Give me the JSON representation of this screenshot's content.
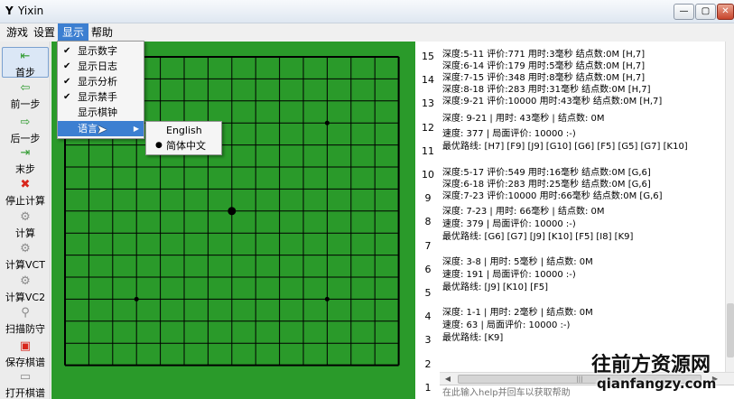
{
  "window": {
    "title": "Yixin",
    "icon": "app-logo-icon"
  },
  "window_controls": {
    "minimize": "—",
    "maximize": "▢",
    "close": "✕"
  },
  "menubar": [
    {
      "label": "游戏"
    },
    {
      "label": "设置"
    },
    {
      "label": "显示",
      "active": true
    },
    {
      "label": "帮助"
    }
  ],
  "toolbar": [
    {
      "label": "首步",
      "icon": "first-step-icon",
      "glyph": "⇤",
      "color": "green",
      "selected": true
    },
    {
      "label": "前一步",
      "icon": "prev-step-icon",
      "glyph": "⇦",
      "color": "green"
    },
    {
      "label": "后一步",
      "icon": "next-step-icon",
      "glyph": "⇨",
      "color": "green"
    },
    {
      "label": "末步",
      "icon": "last-step-icon",
      "glyph": "⇥",
      "color": "green"
    },
    {
      "label": "停止计算",
      "icon": "stop-icon",
      "glyph": "✖",
      "color": "red"
    },
    {
      "label": "计算",
      "icon": "gear-icon",
      "glyph": "⚙",
      "color": "gray"
    },
    {
      "label": "计算VCT",
      "icon": "gear-icon",
      "glyph": "⚙",
      "color": "gray"
    },
    {
      "label": "计算VC2",
      "icon": "gear-icon",
      "glyph": "⚙",
      "color": "gray"
    },
    {
      "label": "扫描防守",
      "icon": "search-icon",
      "glyph": "⚲",
      "color": "gray"
    },
    {
      "label": "保存棋谱",
      "icon": "save-icon",
      "glyph": "▣",
      "color": "red"
    },
    {
      "label": "打开棋谱",
      "icon": "open-folder-icon",
      "glyph": "▭",
      "color": "gray"
    }
  ],
  "display_menu": [
    {
      "label": "显示数字",
      "checked": true
    },
    {
      "label": "显示日志",
      "checked": true
    },
    {
      "label": "显示分析",
      "checked": true
    },
    {
      "label": "显示禁手",
      "checked": true
    },
    {
      "label": "显示棋钟",
      "checked": false
    },
    {
      "label": "语言",
      "checked": false,
      "submenu": true,
      "highlight": true
    }
  ],
  "language_submenu": [
    {
      "label": "English",
      "selected": false
    },
    {
      "label": "简体中文",
      "selected": true
    }
  ],
  "board": {
    "size": 15,
    "stones": [
      {
        "col": 8,
        "row": 8,
        "color": "black"
      }
    ],
    "star_points": [
      [
        4,
        4
      ],
      [
        12,
        4
      ],
      [
        4,
        12
      ],
      [
        12,
        12
      ]
    ],
    "board_color": "#2a9a2a",
    "line_color": "#000000"
  },
  "row_numbers": [
    "15",
    "14",
    "13",
    "12",
    "11",
    "10",
    "9",
    "8",
    "7",
    "6",
    "5",
    "4",
    "3",
    "2",
    "1"
  ],
  "log_lines": [
    "深度:5-11 评价:771 用时:3毫秒 结点数:0M [H,7]",
    "深度:6-14 评价:179 用时:5毫秒 结点数:0M [H,7]",
    "深度:7-15 评价:348 用时:8毫秒 结点数:0M [H,7]",
    "深度:8-18 评价:283 用时:31毫秒 结点数:0M [H,7]",
    "深度:9-21 评价:10000 用时:43毫秒 结点数:0M [H,7]",
    "深度: 9-21 | 用时: 43毫秒 | 结点数: 0M",
    "速度: 377 | 局面评价: 10000 :-)",
    "最优路线: [H7] [F9] [J9] [G10] [G6] [F5] [G5] [G7] [K10]",
    "",
    "深度:5-17 评价:549 用时:16毫秒 结点数:0M [G,6]",
    "深度:6-18 评价:283 用时:25毫秒 结点数:0M [G,6]",
    "深度:7-23 评价:10000 用时:66毫秒 结点数:0M [G,6]",
    "深度: 7-23 | 用时: 66毫秒 | 结点数: 0M",
    "速度: 379 | 局面评价: 10000 :-)",
    "最优路线: [G6] [G7] [J9] [K10] [F5] [I8] [K9]",
    "",
    "深度: 3-8 | 用时: 5毫秒 | 结点数: 0M",
    "速度: 191 | 局面评价: 10000 :-)",
    "最优路线: [J9] [K10] [F5]",
    "",
    "深度: 1-1 | 用时: 2毫秒 | 结点数: 0M",
    "速度: 63 | 局面评价: 10000 :-)",
    "最优路线: [K9]"
  ],
  "input": {
    "placeholder": "在此输入help并回车以获取帮助",
    "value": ""
  },
  "scrollbar": {
    "thumb_label": "|||"
  },
  "watermark": {
    "title": "往前方资源网",
    "url": "qianfangzy.com"
  }
}
